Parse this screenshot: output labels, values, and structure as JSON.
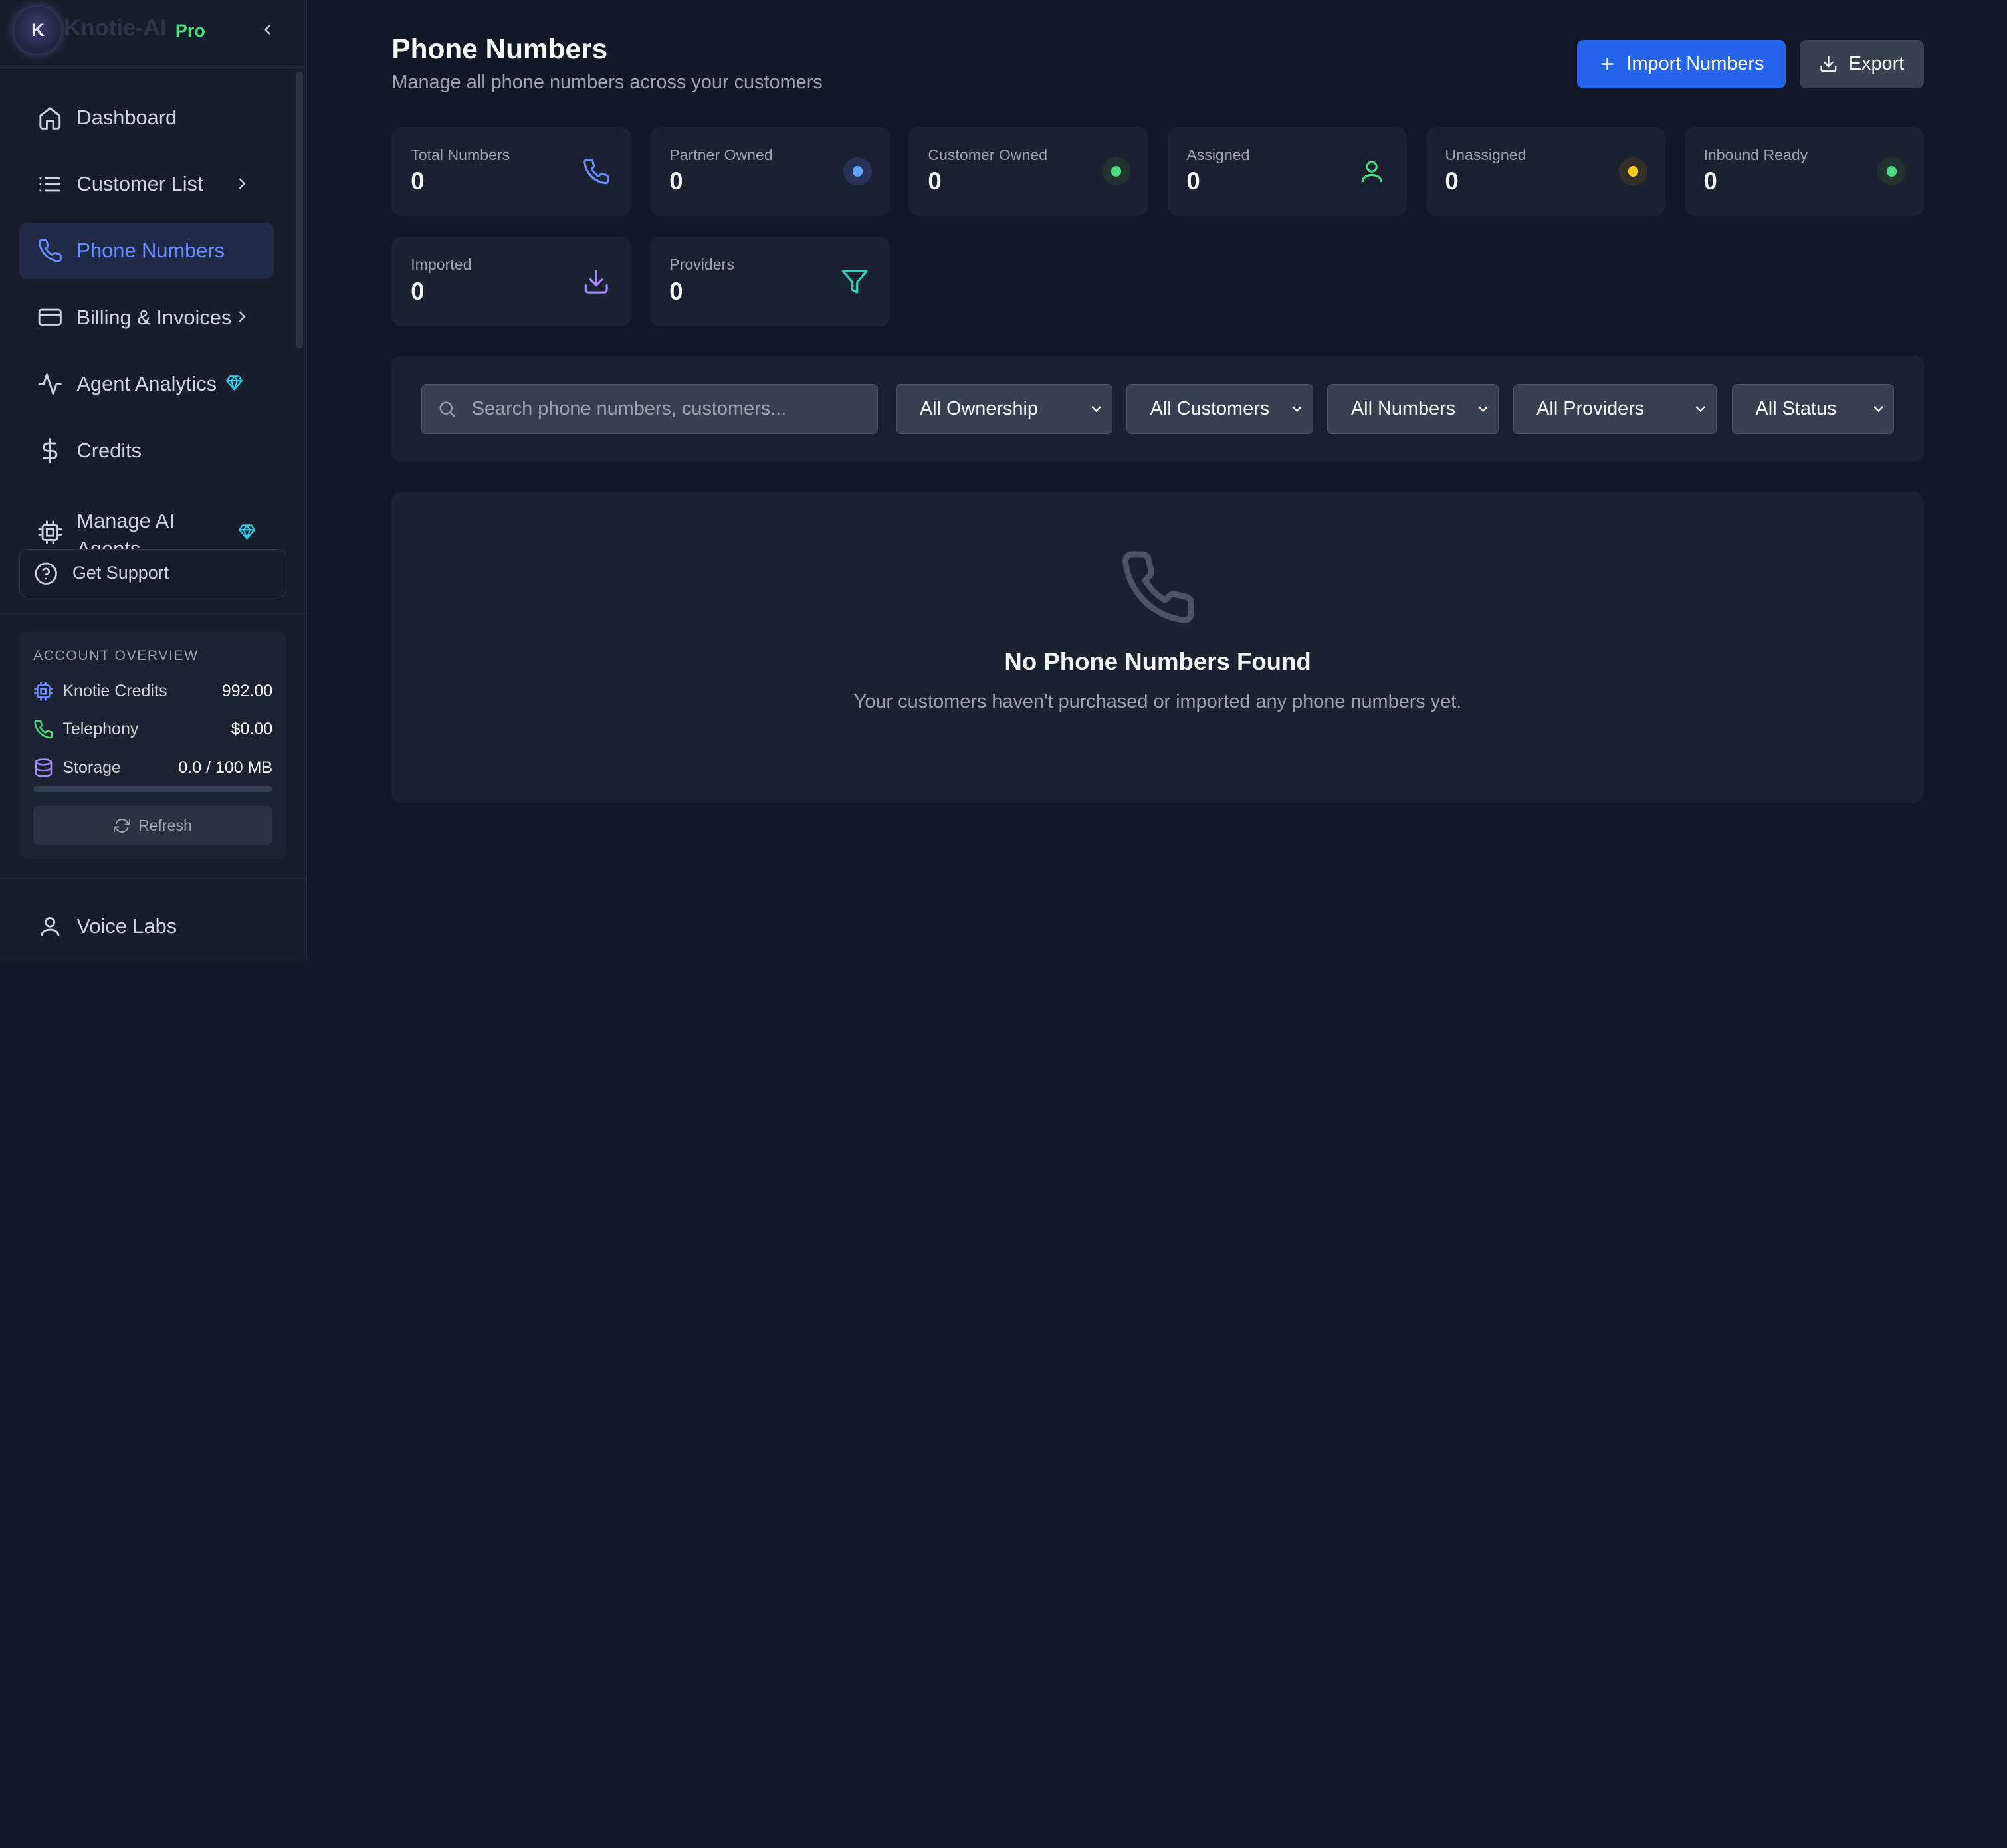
{
  "brand": {
    "initial": "K",
    "name": "Knotie-AI",
    "tier": "Pro"
  },
  "sidebar": {
    "items": [
      {
        "label": "Dashboard",
        "icon": "home-icon"
      },
      {
        "label": "Customer List",
        "icon": "list-icon",
        "has_submenu": true
      },
      {
        "label": "Phone Numbers",
        "icon": "phone-icon",
        "active": true
      },
      {
        "label": "Billing & Invoices",
        "icon": "credit-card-icon",
        "has_submenu": true
      },
      {
        "label": "Agent Analytics",
        "icon": "activity-icon",
        "premium": true
      },
      {
        "label": "Credits",
        "icon": "dollar-icon"
      },
      {
        "label": "Manage AI Agents",
        "icon": "cpu-icon",
        "premium": true
      }
    ],
    "support_label": "Get Support",
    "account": {
      "title": "ACCOUNT OVERVIEW",
      "rows": [
        {
          "label": "Knotie Credits",
          "value": "992.00",
          "icon": "cpu-icon"
        },
        {
          "label": "Telephony",
          "value": "$0.00",
          "icon": "phone-icon"
        },
        {
          "label": "Storage",
          "value": "0.0 / 100 MB",
          "icon": "database-icon"
        }
      ],
      "storage_used_fraction": 0.0,
      "refresh_label": "Refresh"
    },
    "footer_item": {
      "label": "Voice Labs",
      "icon": "user-icon"
    }
  },
  "header": {
    "title": "Phone Numbers",
    "subtitle": "Manage all phone numbers across your customers",
    "import_label": "Import Numbers",
    "export_label": "Export"
  },
  "stats": [
    {
      "label": "Total Numbers",
      "value": "0",
      "icon": "phone-icon"
    },
    {
      "label": "Partner Owned",
      "value": "0",
      "indicator": "blue"
    },
    {
      "label": "Customer Owned",
      "value": "0",
      "indicator": "green"
    },
    {
      "label": "Assigned",
      "value": "0",
      "icon": "user-icon"
    },
    {
      "label": "Unassigned",
      "value": "0",
      "indicator": "yellow"
    },
    {
      "label": "Inbound Ready",
      "value": "0",
      "indicator": "green"
    },
    {
      "label": "Imported",
      "value": "0",
      "icon": "download-icon"
    },
    {
      "label": "Providers",
      "value": "0",
      "icon": "filter-icon"
    }
  ],
  "filters": {
    "search_placeholder": "Search phone numbers, customers...",
    "ownership": "All Ownership",
    "customers": "All Customers",
    "numbers": "All Numbers",
    "providers": "All Providers",
    "status": "All Status"
  },
  "empty_state": {
    "title": "No Phone Numbers Found",
    "message": "Your customers haven't purchased or imported any phone numbers yet."
  },
  "colors": {
    "accent": "#2563eb",
    "active_nav": "#6b8cff",
    "pro": "#4ade80",
    "premium_gem": "#22d3ee",
    "dot_blue": "#60a5fa",
    "dot_green": "#4ade80",
    "dot_yellow": "#facc15"
  }
}
